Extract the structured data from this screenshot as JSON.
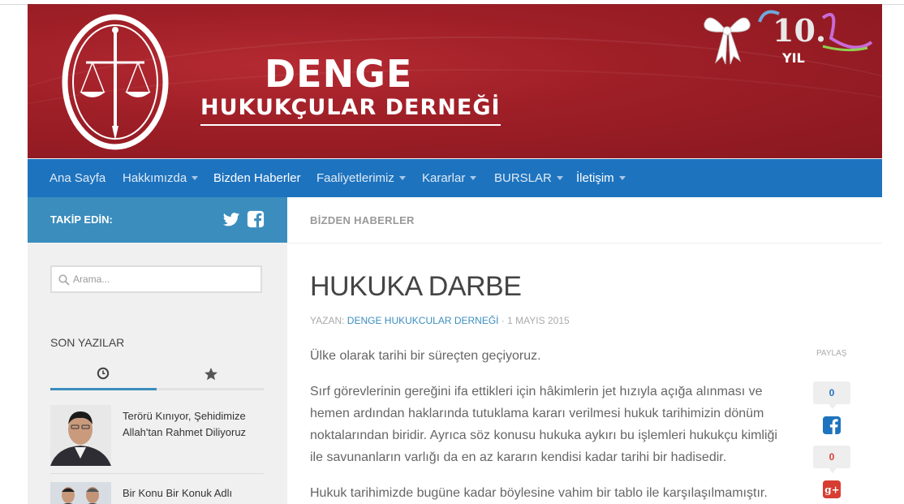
{
  "header": {
    "logo_title": "DENGE",
    "logo_subtitle": "HUKUKÇULAR DERNEĞİ",
    "anniversary_number": "10.",
    "anniversary_word": "YIL",
    "colors": {
      "brand_red": "#9d1e26",
      "nav_blue": "#1e73be",
      "accent_blue": "#3b8dbd"
    }
  },
  "nav": {
    "items": [
      {
        "label": "Ana Sayfa",
        "has_dropdown": false
      },
      {
        "label": "Hakkımızda",
        "has_dropdown": true
      },
      {
        "label": "Bizden Haberler",
        "has_dropdown": false,
        "active": true
      },
      {
        "label": "Faaliyetlerimiz",
        "has_dropdown": true
      },
      {
        "label": "Kararlar",
        "has_dropdown": true
      },
      {
        "label": "BURSLAR",
        "has_dropdown": true
      },
      {
        "label": "İletişim",
        "has_dropdown": true
      }
    ]
  },
  "sidebar": {
    "follow_label": "TAKİP EDİN:",
    "social_icons": [
      "twitter-icon",
      "facebook-icon"
    ],
    "search": {
      "placeholder": "Arama..."
    },
    "recent_title": "SON YAZILAR",
    "tab_icons": [
      "clock-icon",
      "star-icon"
    ],
    "posts": [
      {
        "title": "Terörü Kınıyor, Şehidimize Allah'tan Rahmet Diliyoruz"
      },
      {
        "title": "Bir Konu Bir Konuk Adlı"
      }
    ]
  },
  "main": {
    "breadcrumb": "BİZDEN HABERLER",
    "title": "HUKUKA DARBE",
    "meta_prefix": "YAZAN:",
    "author": "DENGE HUKUKCULAR DERNEĞİ",
    "meta_sep": " · ",
    "date": "1 MAYIS 2015",
    "paragraphs": [
      "Ülke olarak tarihi bir süreçten geçiyoruz.",
      "Sırf görevlerinin gereğini ifa ettikleri için hâkimlerin jet hızıyla açığa alınması ve hemen ardından haklarında tutuklama kararı verilmesi hukuk tarihimizin dönüm noktalarından biridir. Ayrıca söz konusu hukuka aykırı bu işlemleri hukukçu kimliği ile savunanların varlığı da en az kararın kendisi kadar tarihi bir hadisedir.",
      "Hukuk tarihimizde bugüne kadar böylesine vahim bir tablo ile karşılaşılmamıştır."
    ],
    "share": {
      "label": "PAYLAŞ",
      "facebook_count": "0",
      "googleplus_count": "0",
      "facebook_color": "#1e73be",
      "googleplus_color": "#d73d32"
    }
  }
}
